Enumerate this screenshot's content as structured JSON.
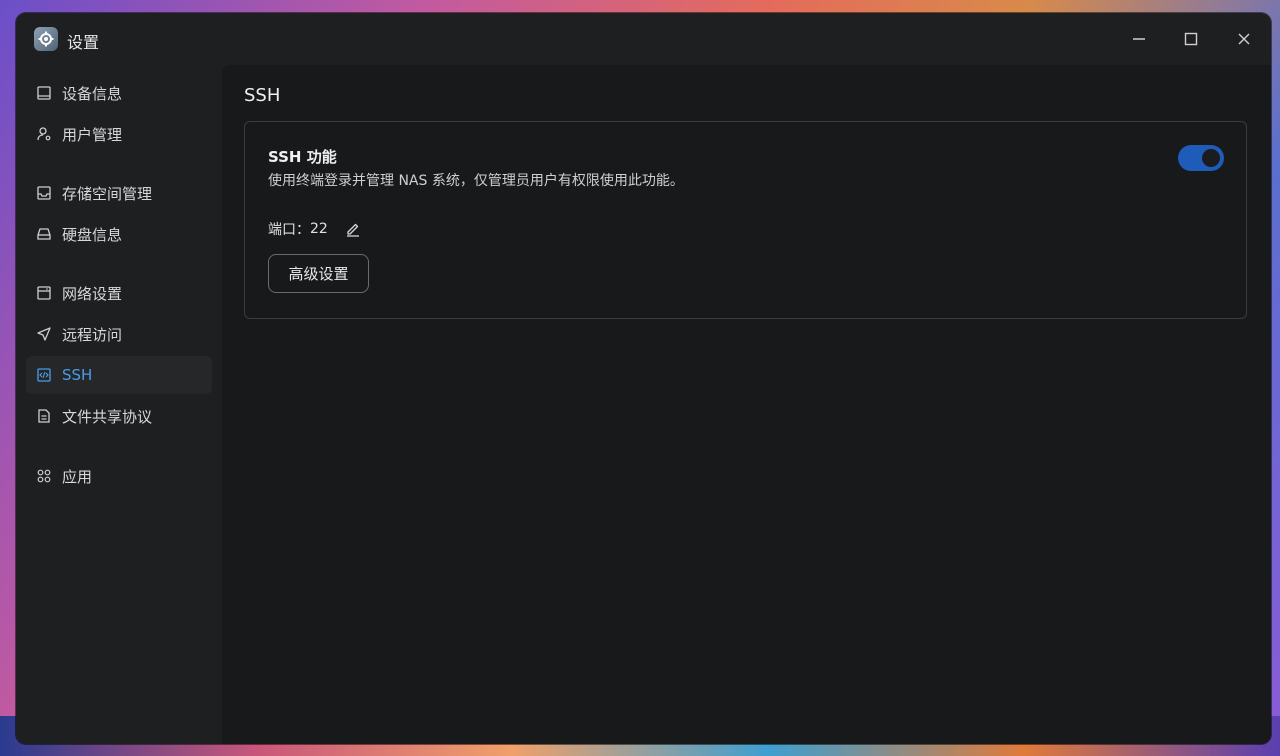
{
  "window": {
    "title": "设置"
  },
  "sidebar": {
    "items": [
      {
        "label": "设备信息",
        "icon": "device-icon"
      },
      {
        "label": "用户管理",
        "icon": "user-gear-icon"
      },
      {
        "label": "存储空间管理",
        "icon": "storage-icon"
      },
      {
        "label": "硬盘信息",
        "icon": "disk-icon"
      },
      {
        "label": "网络设置",
        "icon": "network-icon"
      },
      {
        "label": "远程访问",
        "icon": "send-icon"
      },
      {
        "label": "SSH",
        "icon": "code-icon",
        "active": true
      },
      {
        "label": "文件共享协议",
        "icon": "document-icon"
      },
      {
        "label": "应用",
        "icon": "apps-icon"
      }
    ]
  },
  "main": {
    "title": "SSH",
    "card": {
      "title": "SSH 功能",
      "description": "使用终端登录并管理 NAS 系统，仅管理员用户有权限使用此功能。",
      "toggle_on": true,
      "port_label": "端口：",
      "port_value": "22",
      "advanced_button": "高级设置"
    }
  },
  "colors": {
    "accent": "#4a9de8",
    "toggle": "#1f5bb8"
  }
}
